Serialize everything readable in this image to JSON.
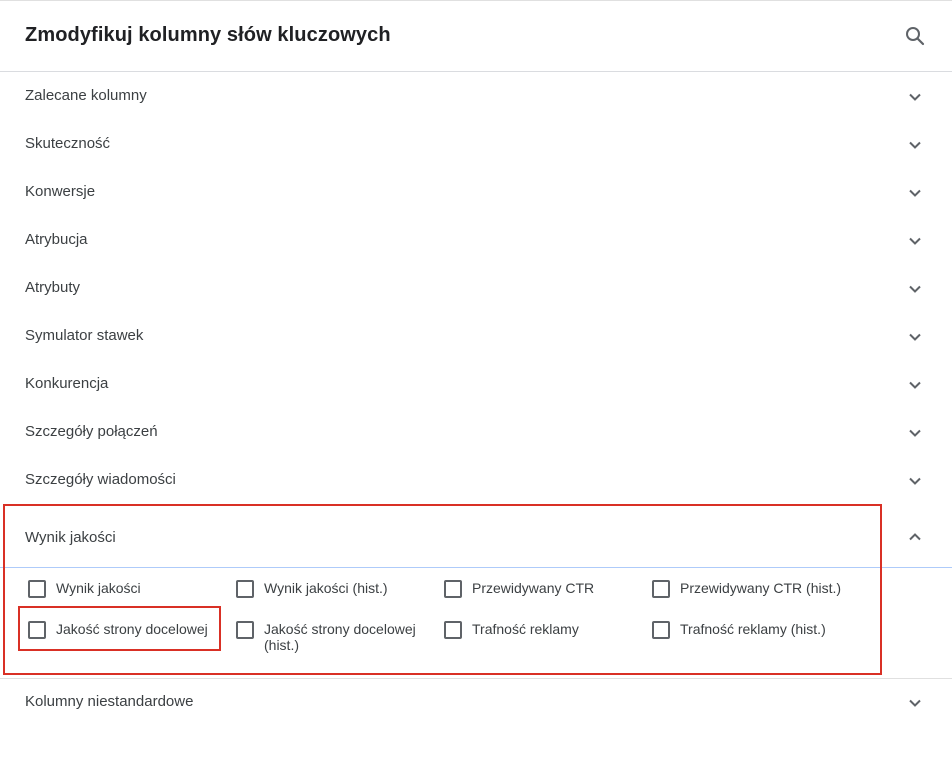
{
  "dialog": {
    "title": "Zmodyfikuj kolumny słów kluczowych",
    "search_icon": "search-icon"
  },
  "sections": [
    {
      "label": "Zalecane kolumny"
    },
    {
      "label": "Skuteczność"
    },
    {
      "label": "Konwersje"
    },
    {
      "label": "Atrybucja"
    },
    {
      "label": "Atrybuty"
    },
    {
      "label": "Symulator stawek"
    },
    {
      "label": "Konkurencja"
    },
    {
      "label": "Szczegóły połączeń"
    },
    {
      "label": "Szczegóły wiadomości"
    }
  ],
  "expanded_section": {
    "label": "Wynik jakości",
    "options": [
      {
        "label": "Wynik jakości",
        "checked": false
      },
      {
        "label": "Wynik jakości (hist.)",
        "checked": false
      },
      {
        "label": "Przewidywany CTR",
        "checked": false
      },
      {
        "label": "Przewidywany CTR (hist.)",
        "checked": false
      },
      {
        "label": "Jakość strony docelowej",
        "checked": false
      },
      {
        "label": "Jakość strony docelowej (hist.)",
        "checked": false
      },
      {
        "label": "Trafność reklamy",
        "checked": false
      },
      {
        "label": "Trafność reklamy (hist.)",
        "checked": false
      }
    ]
  },
  "last_section": {
    "label": "Kolumny niestandardowe"
  },
  "colors": {
    "highlight": "#d93025",
    "focus_line": "#aecbfa",
    "text": "#3c4043"
  }
}
